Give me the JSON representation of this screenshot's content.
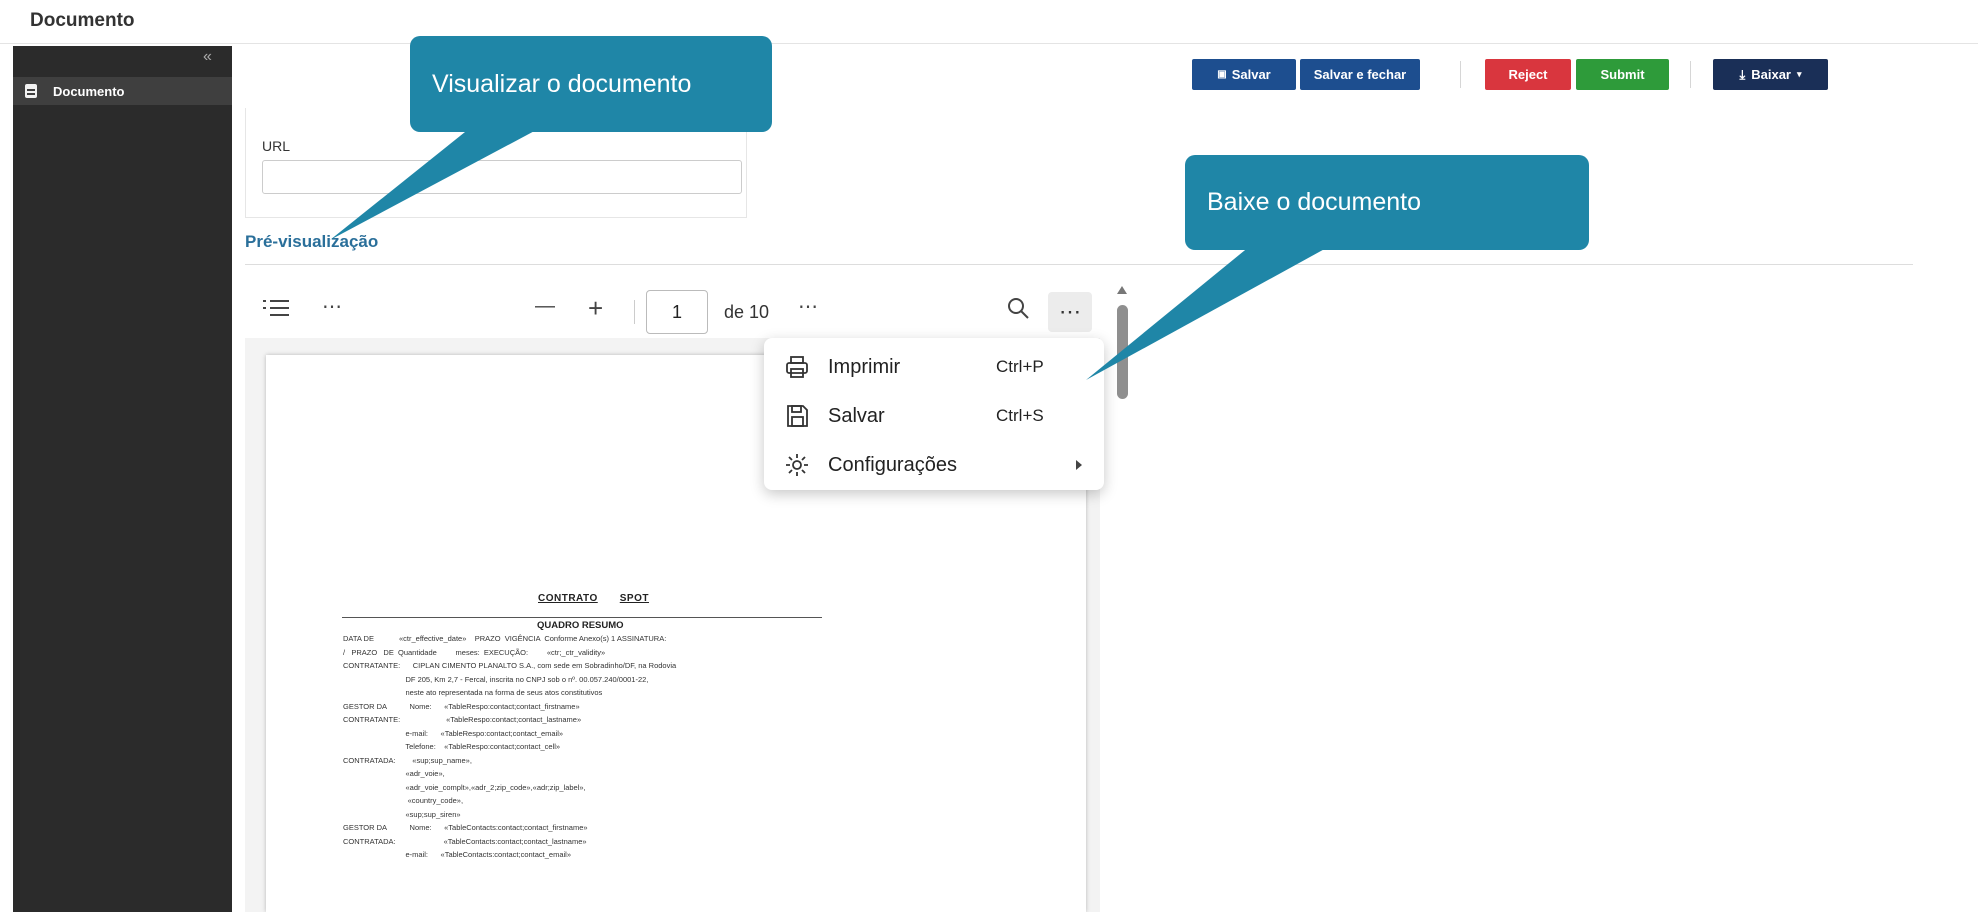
{
  "page_title": "Documento",
  "sidebar": {
    "collapse_glyph": "«",
    "items": [
      {
        "label": "Documento",
        "icon": "document-icon"
      }
    ]
  },
  "toolbar": {
    "save": "Salvar",
    "save_close": "Salvar e fechar",
    "reject": "Reject",
    "submit": "Submit",
    "download": "Baixar",
    "colors": {
      "primary": "#1d4e8f",
      "reject": "#d9363e",
      "submit": "#2e9b3a",
      "download": "#1a2f57"
    }
  },
  "url_field": {
    "label": "URL",
    "value": ""
  },
  "preview": {
    "title": "Pré-visualização"
  },
  "viewer": {
    "current_page": "1",
    "page_total": "de 10"
  },
  "context_menu": {
    "items": [
      {
        "label": "Imprimir",
        "shortcut": "Ctrl+P",
        "icon": "printer-icon"
      },
      {
        "label": "Salvar",
        "shortcut": "Ctrl+S",
        "icon": "save-icon"
      },
      {
        "label": "Configurações",
        "shortcut": "",
        "icon": "settings-icon"
      }
    ]
  },
  "callouts": {
    "view": "Visualizar o documento",
    "download": "Baixe o documento",
    "color": "#1f86a7"
  },
  "document": {
    "heading_1": "CONTRATO",
    "heading_2": "SPOT",
    "subheading": "QUADRO RESUMO",
    "lines": [
      "DATA DE            «ctr_effective_date»    PRAZO  VIGÊNCIA  Conforme Anexo(s) 1 ASSINATURA:",
      "/   PRAZO   DE  Quantidade         meses:  EXECUÇÃO:         «ctr;_ctr_validity»",
      "CONTRATANTE:      CIPLAN CIMENTO PLANALTO S.A., com sede em Sobradinho/DF, na Rodovia",
      "                              DF 205, Km 2,7 - Fercal, inscrita no CNPJ sob o nº. 00.057.240/0001-22,",
      "                              neste ato representada na forma de seus atos constitutivos",
      "GESTOR DA           Nome:      «TableRespo:contact;contact_firstname»",
      "CONTRATANTE:                      «TableRespo:contact;contact_lastname»",
      "                              e-mail:      «TableRespo:contact;contact_email»",
      "                              Telefone:    «TableRespo:contact;contact_cell»",
      "CONTRATADA:        «sup;sup_name»,",
      "                              «adr_voie»,",
      "                              «adr_voie_complt»,«adr_2;zip_code»,«adr;zip_label»,",
      "                               «country_code»,",
      "                              «sup;sup_siren»",
      "GESTOR DA           Nome:      «TableContacts:contact;contact_firstname»",
      "CONTRATADA:                       «TableContacts:contact;contact_lastname»",
      "                              e-mail:      «TableContacts:contact;contact_email»"
    ]
  }
}
